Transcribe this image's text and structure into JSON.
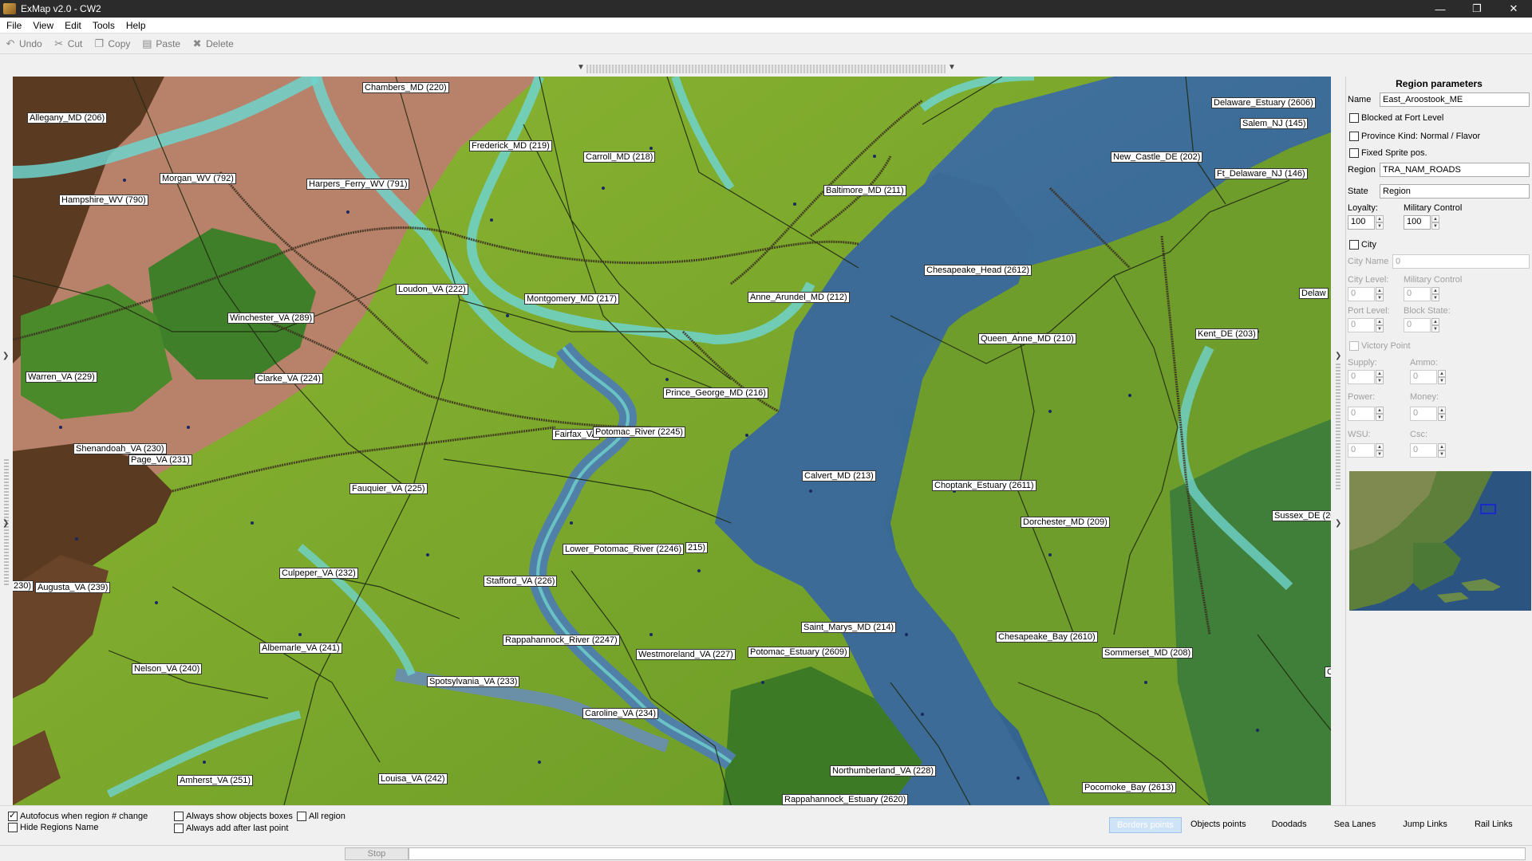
{
  "window": {
    "title": "ExMap v2.0 - CW2",
    "minimize": "—",
    "maximize": "❐",
    "close": "✕"
  },
  "menu": [
    "File",
    "View",
    "Edit",
    "Tools",
    "Help"
  ],
  "toolbar": [
    {
      "label": "Undo",
      "icon": "undo-icon"
    },
    {
      "label": "Cut",
      "icon": "cut-icon"
    },
    {
      "label": "Copy",
      "icon": "copy-icon"
    },
    {
      "label": "Paste",
      "icon": "paste-icon"
    },
    {
      "label": "Delete",
      "icon": "delete-icon"
    }
  ],
  "map_labels": [
    {
      "text": "Chambers_MD (220)"
    },
    {
      "text": "Allegany_MD (206)"
    },
    {
      "text": "Frederick_MD (219)"
    },
    {
      "text": "Carroll_MD (218)"
    },
    {
      "text": "Morgan_WV (792)"
    },
    {
      "text": "Harpers_Ferry_WV (791)"
    },
    {
      "text": "Hampshire_WV (790)"
    },
    {
      "text": "Baltimore_MD (211)"
    },
    {
      "text": "Delaware_Estuary (2606)"
    },
    {
      "text": "Salem_NJ (145)"
    },
    {
      "text": "New_Castle_DE (202)"
    },
    {
      "text": "Ft_Delaware_NJ (146)"
    },
    {
      "text": "Chesapeake_Head (2612)"
    },
    {
      "text": "Loudon_VA (222)"
    },
    {
      "text": "Montgomery_MD (217)"
    },
    {
      "text": "Anne_Arundel_MD (212)"
    },
    {
      "text": "Winchester_VA (289)"
    },
    {
      "text": "Delaw"
    },
    {
      "text": "Queen_Anne_MD (210)"
    },
    {
      "text": "Kent_DE (203)"
    },
    {
      "text": "Warren_VA (229)"
    },
    {
      "text": "Clarke_VA (224)"
    },
    {
      "text": "Prince_George_MD (216)"
    },
    {
      "text": "Fairfax_VA"
    },
    {
      "text": "Potomac_River (2245)"
    },
    {
      "text": "Shenandoah_VA (230)"
    },
    {
      "text": "Page_VA (231)"
    },
    {
      "text": "Calvert_MD (213)"
    },
    {
      "text": "Choptank_Estuary (2611)"
    },
    {
      "text": "Fauquier_VA (225)"
    },
    {
      "text": "Dorchester_MD (209)"
    },
    {
      "text": "Sussex_DE (20"
    },
    {
      "text": "Lower_Potomac_River (2246)"
    },
    {
      "text": "215)"
    },
    {
      "text": "Culpeper_VA (232)"
    },
    {
      "text": "Stafford_VA (226)"
    },
    {
      "text": "230)"
    },
    {
      "text": "Augusta_VA (239)"
    },
    {
      "text": "Saint_Marys_MD (214)"
    },
    {
      "text": "Chesapeake_Bay (2610)"
    },
    {
      "text": "Rappahannock_River (2247)"
    },
    {
      "text": "Albemarle_VA (241)"
    },
    {
      "text": "Westmoreland_VA (227)"
    },
    {
      "text": "Potomac_Estuary (2609)"
    },
    {
      "text": "Sommerset_MD (208)"
    },
    {
      "text": "Nelson_VA (240)"
    },
    {
      "text": "Spotsylvania_VA (233)"
    },
    {
      "text": "Caroline_VA (234)"
    },
    {
      "text": "Northumberland_VA (228)"
    },
    {
      "text": "Amherst_VA (251)"
    },
    {
      "text": "Louisa_VA (242)"
    },
    {
      "text": "Pocomoke_Bay (2613)"
    },
    {
      "text": "Rappahannock_Estuary (2620)"
    },
    {
      "text": "C"
    }
  ],
  "panel": {
    "title": "Region parameters",
    "name_label": "Name",
    "name_value": "East_Aroostook_ME",
    "blocked_label": "Blocked at Fort Level",
    "province_kind_label": "Province Kind: Normal / Flavor",
    "fixed_sprite_label": "Fixed Sprite pos.",
    "region_label": "Region",
    "region_value": "TRA_NAM_ROADS",
    "state_label": "State",
    "state_value": "Region",
    "loyalty_label": "Loyalty:",
    "loyalty_value": "100",
    "military_control_label": "Military Control",
    "military_control_value": "100",
    "city_label": "City",
    "city_name_label": "City Name",
    "city_name_value": "0",
    "city_level_label": "City Level:",
    "city_level_value": "0",
    "city_military_label": "Military Control",
    "city_military_value": "0",
    "port_level_label": "Port Level:",
    "port_level_value": "0",
    "block_state_label": "Block State:",
    "block_state_value": "0",
    "victory_label": "Victory Point",
    "supply_label": "Supply:",
    "supply_value": "0",
    "ammo_label": "Ammo:",
    "ammo_value": "0",
    "power_label": "Power:",
    "power_value": "0",
    "money_label": "Money:",
    "money_value": "0",
    "wsu_label": "WSU:",
    "wsu_value": "0",
    "csc_label": "Csc:",
    "csc_value": "0"
  },
  "bottom": {
    "autofocus_label": "Autofocus when region # change",
    "hide_names_label": "Hide Regions Name",
    "always_show_label": "Always show objects boxes",
    "all_region_label": "All region",
    "always_add_label": "Always add after last point",
    "tabs": [
      "Borders points",
      "Objects points",
      "Doodads",
      "Sea Lanes",
      "Jump Links",
      "Rail Links"
    ]
  },
  "status": {
    "stop_label": "Stop"
  },
  "colors": {
    "titlebar": "#2b2b2b",
    "water": "#3f6f9a",
    "shore": "#6fd3cc",
    "green": "#7ba52a",
    "dark_green": "#3f7a22",
    "brown": "#b8826a",
    "dark_brown": "#5b3a22",
    "active_tab": "#cfe3f7"
  }
}
